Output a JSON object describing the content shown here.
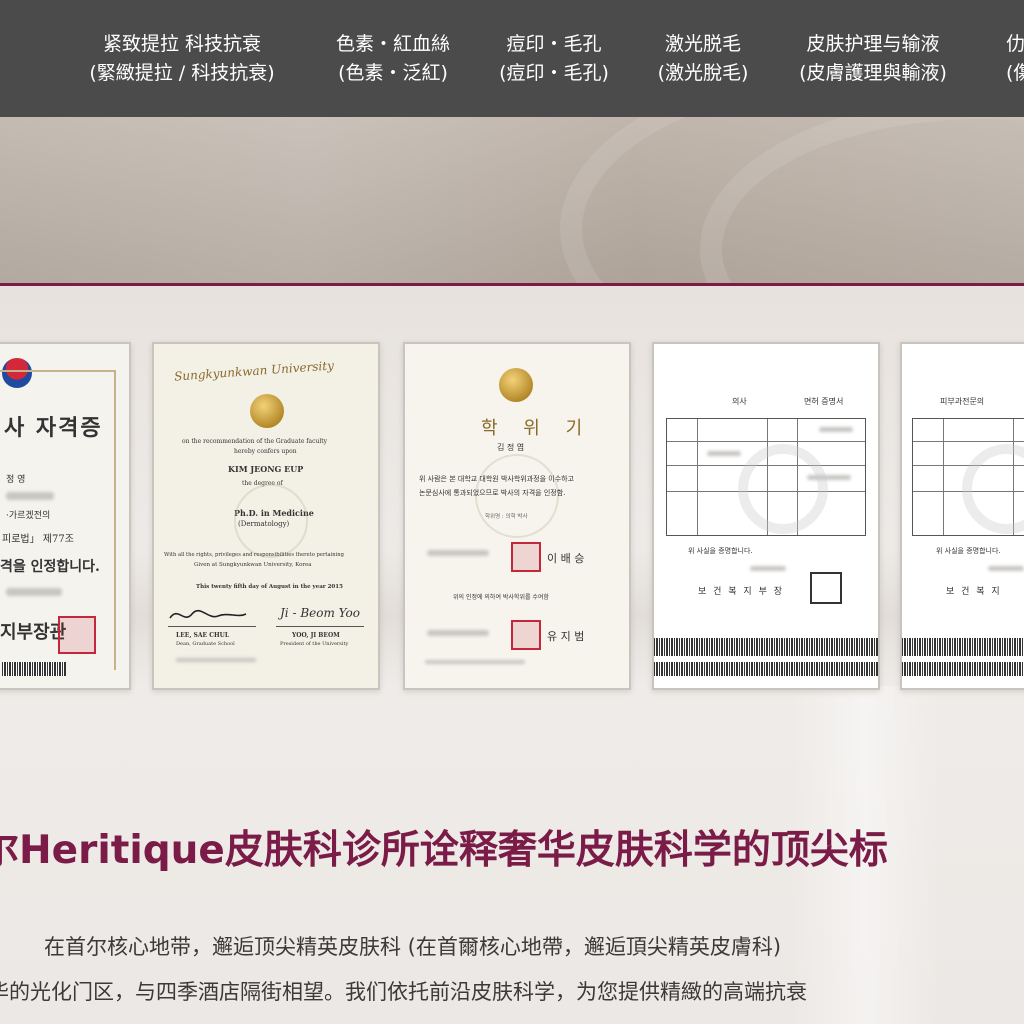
{
  "nav": {
    "items": [
      {
        "line1": "紧致提拉 科技抗衰",
        "line2": "(緊緻提拉 / 科技抗衰)"
      },
      {
        "line1": "色素・紅血絲",
        "line2": "(色素・泛紅)"
      },
      {
        "line1": "痘印・毛孔",
        "line2": "(痘印・毛孔)"
      },
      {
        "line1": "激光脱毛",
        "line2": "(激光脫毛)"
      },
      {
        "line1": "皮肤护理与输液",
        "line2": "(皮膚護理與輸液)"
      },
      {
        "line1": "仂",
        "line2": "(傷"
      }
    ]
  },
  "certificates": {
    "c1": {
      "title": "사 자격증",
      "l1": "정 영",
      "l2": "·가르겠전의",
      "l3": "피로법」 제77조",
      "l4": "격을 인정합니다.",
      "issuer": "지부장관"
    },
    "c2": {
      "university": "Sungkyunkwan University",
      "rec": "on the recommendation of the Graduate faculty",
      "conf": "hereby confers upon",
      "name": "KIM JEONG EUP",
      "degree_of": "the degree of",
      "degree": "Ph.D. in Medicine",
      "major": "(Dermatology)",
      "rights": "With all the rights, privileges and responsibilities thereto pertaining",
      "given": "Given at Sungkyunkwan University, Korea",
      "date": "This twenty fifth day of August in the year 2015",
      "sig1": "LEE, SAE CHUL",
      "sig1_title": "Dean, Graduate School",
      "sig2_script": "Ji - Beom Yoo",
      "sig2": "YOO, JI BEOM",
      "sig2_title": "President of the University"
    },
    "c3": {
      "title": "학 위 기",
      "name": "김 정 엽",
      "body1": "위 사람은 본 대학교 대학원 박사학위과정을 이수하고",
      "body2": "논문심사에 통과되었으므로 박사의 자격을 인정함.",
      "field": "학위명 : 의학 박사",
      "sig_a": "이 배 승",
      "award": "위의 인정에 의하여 박사학위를 수여함",
      "sig_b": "유 지 범"
    },
    "c4": {
      "head1": "의사",
      "head2": "면허 증명서",
      "confirm": "위 사실을 증명합니다.",
      "ministry": "보 건 복 지 부 장"
    },
    "c5": {
      "head": "피부과전문의",
      "confirm": "위 사실을 증명합니다.",
      "ministry": "보 건 복 지"
    }
  },
  "main": {
    "headline": "尔Heritique皮肤科诊所诠释奢华皮肤科学的顶尖标",
    "para1": "在首尔核心地带，邂逅顶尖精英皮肤科 (在首爾核心地帶，邂逅頂尖精英皮膚科)",
    "para2": "华的光化门区，与四季酒店隔街相望。我们依托前沿皮肤科学，为您提供精緻的高端抗衰"
  },
  "colors": {
    "nav_bg": "#4b4b4b",
    "accent": "#7a1c47",
    "text": "#3a3a3a"
  }
}
